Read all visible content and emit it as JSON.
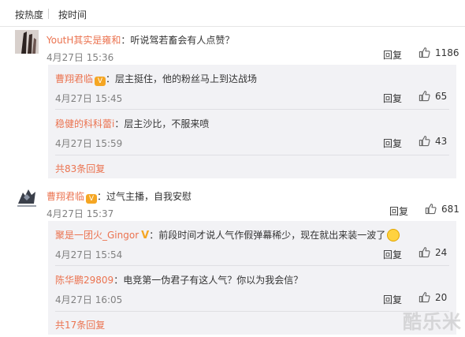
{
  "sort_tabs": [
    "按热度",
    "按时间"
  ],
  "comments": [
    {
      "user": "YoutH其实是雍和",
      "text": "：听说驾若畜会有人点赞？",
      "time": "4月27日 15:36",
      "reply_label": "回复",
      "likes": "1186",
      "replies": [
        {
          "user": "曹翔君临",
          "badge": "vip",
          "text": "：层主挺住，他的粉丝马上到达战场",
          "time": "4月27日 15:45",
          "reply_label": "回复",
          "likes": "65"
        },
        {
          "user": "稳健的科科蕾i",
          "text": "：层主沙比，不服来喷",
          "time": "4月27日 15:59",
          "reply_label": "回复",
          "likes": "43"
        }
      ],
      "more": "共83条回复"
    },
    {
      "user": "曹翔君临",
      "badge": "vip",
      "text": "：过气主播，自我安慰",
      "time": "4月27日 15:37",
      "reply_label": "回复",
      "likes": "681",
      "replies": [
        {
          "user": "聚是一团火_Gingor",
          "badge": "crown",
          "text": "：前段时间才说人气作假弹幕稀少，现在就出来装一波了",
          "emoji": "smile",
          "time": "4月27日 15:54",
          "reply_label": "回复",
          "likes": "24"
        },
        {
          "user": "陈华鹏29809",
          "text": "：电竞第一伪君子有这人气？你以为我会信？",
          "time": "4月27日 16:05",
          "reply_label": "回复",
          "likes": "20"
        }
      ],
      "more": "共17条回复"
    }
  ],
  "watermark": "酷乐米",
  "colors": {
    "username": "#eb7350",
    "reply_bg": "#f2f2f5",
    "meta": "#808080"
  }
}
